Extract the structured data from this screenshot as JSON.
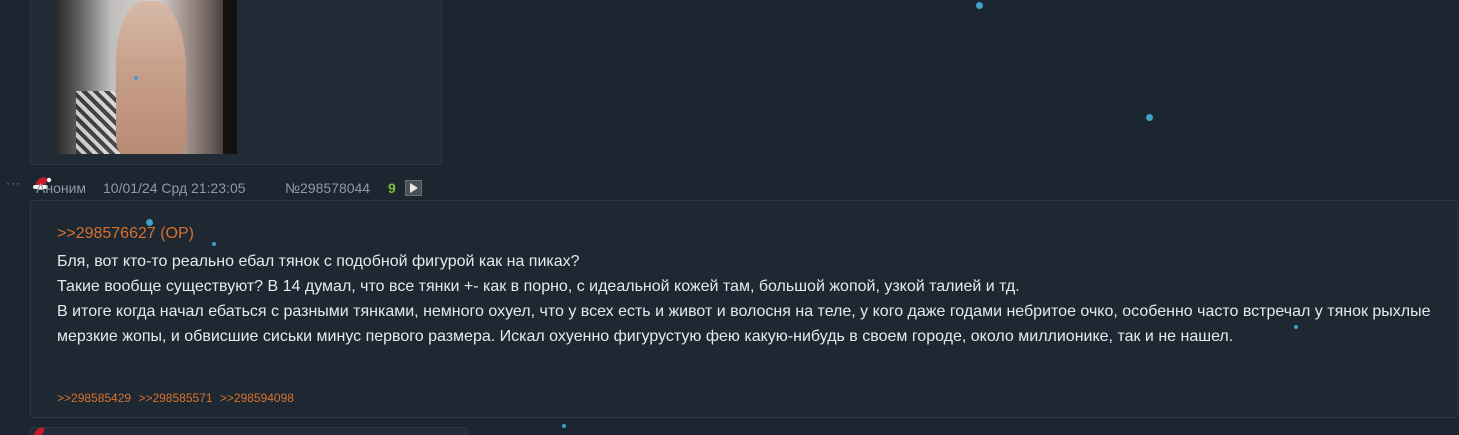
{
  "post": {
    "author": "Аноним",
    "date": "10/01/24 Срд 21:23:05",
    "number": "№298578044",
    "reply_count": "9",
    "op_link": ">>298576627 (OP)",
    "text_lines": [
      "Бля, вот кто-то реально ебал тянок с подобной фигурой как на пиках?",
      "Такие вообще существуют? В 14 думал, что все тянки +- как в порно, с идеальной кожей там, большой жопой, узкой талией и тд.",
      "В итоге когда начал ебаться с разными тянками, немного охуел, что у всех есть и живот и волосня на теле, у кого даже годами небритое очко, особенно часто встречал у тянок рыхлые мерзкие жопы, и обвисшие сиськи минус первого размера. Искал охуенно фигурустую фею какую-нибудь в своем городе, около миллионике, так и не нашел."
    ],
    "replies": [
      ">>298585429",
      ">>298585571",
      ">>298594098"
    ],
    "menu_dots": "···"
  },
  "colors": {
    "background": "#1c2630",
    "post_background": "#1e2833",
    "link": "#d9702b",
    "text": "#e6e9ec",
    "meta": "#8f9aa5",
    "count": "#7bbf3a",
    "snow": "#3fa0c8"
  },
  "icons": {
    "hat": "santa-hat-icon",
    "play": "play-icon",
    "menu": "dots-menu-icon"
  }
}
